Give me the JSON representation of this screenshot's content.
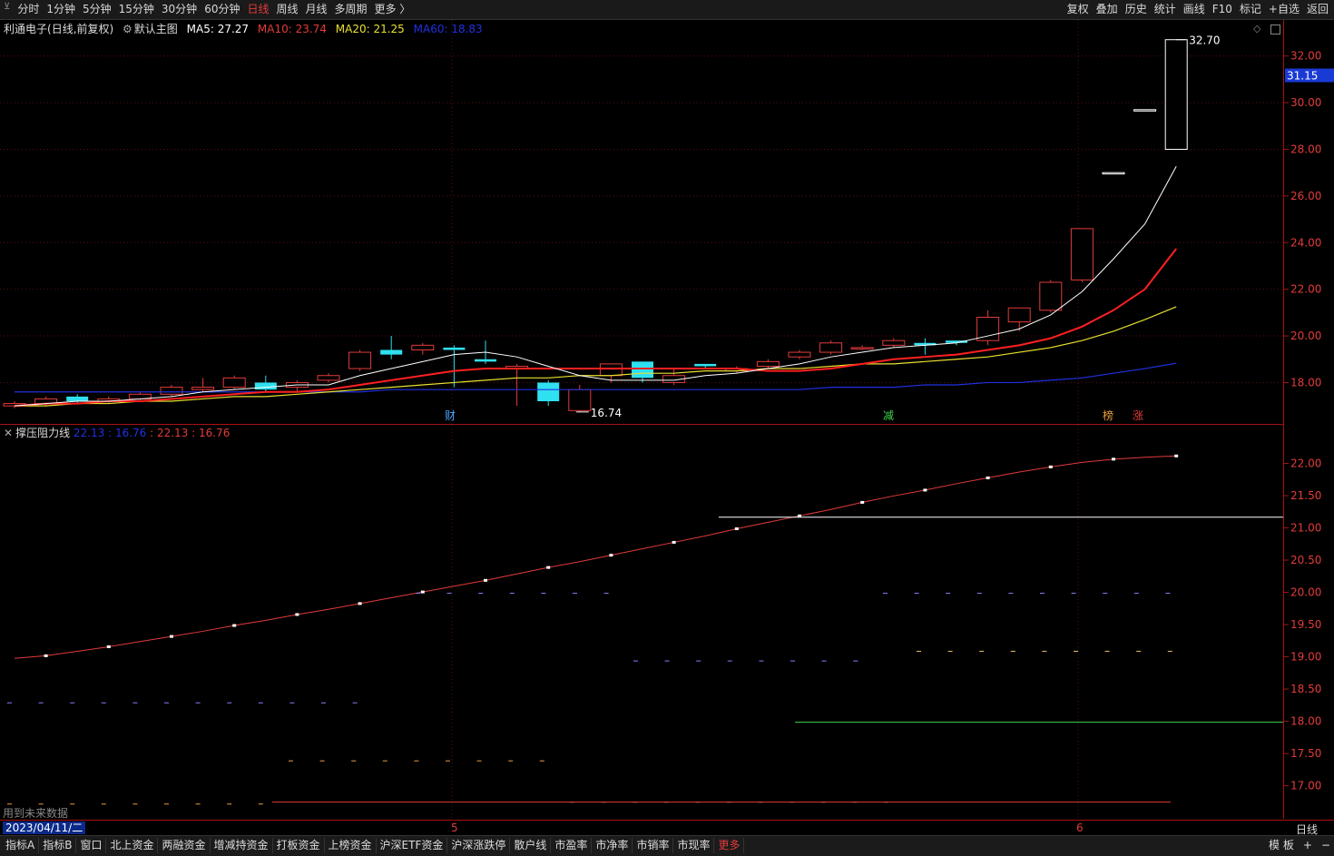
{
  "toolbar": {
    "left_items": [
      "分时",
      "1分钟",
      "5分钟",
      "15分钟",
      "30分钟",
      "60分钟",
      "日线",
      "周线",
      "月线",
      "多周期",
      "更多 〉"
    ],
    "active_index": 6,
    "right_items": [
      "复权",
      "叠加",
      "历史",
      "统计",
      "画线",
      "F10",
      "标记",
      "+自选",
      "返回"
    ]
  },
  "main_chart": {
    "stock_name": "利通电子",
    "period_label": "(日线,前复权)",
    "template_label": "默认主图",
    "ma5": "MA5: 27.27",
    "ma10": "MA10: 23.74",
    "ma20": "MA20: 21.25",
    "ma60": "MA60: 18.83",
    "high_label": "32.70",
    "low_label": "16.74",
    "current_price": "31.15",
    "y_ticks": [
      "32.00",
      "30.00",
      "28.00",
      "26.00",
      "24.00",
      "22.00",
      "20.00",
      "18.00"
    ],
    "markers": [
      {
        "text": "财",
        "color": "#4aa3ff"
      },
      {
        "text": "减",
        "color": "#3cd84c"
      },
      {
        "text": "榜",
        "color": "#e8a040"
      },
      {
        "text": "涨",
        "color": "#e23b3b"
      }
    ],
    "colors": {
      "up": "#e23b3b",
      "down": "#2fe0f0",
      "ma5": "#ffffff",
      "ma10": "#ff2020",
      "ma20": "#e8e030",
      "ma60": "#2030e0"
    }
  },
  "chart_data": {
    "type": "candlestick",
    "y_range": [
      16.5,
      33.0
    ],
    "candles": [
      [
        17.0,
        17.1,
        16.9,
        17.2
      ],
      [
        17.1,
        17.3,
        17.0,
        17.4
      ],
      [
        17.4,
        17.2,
        17.1,
        17.5
      ],
      [
        17.2,
        17.3,
        17.1,
        17.4
      ],
      [
        17.3,
        17.5,
        17.2,
        17.6
      ],
      [
        17.5,
        17.8,
        17.4,
        17.9
      ],
      [
        17.7,
        17.8,
        17.6,
        18.2
      ],
      [
        17.8,
        18.2,
        17.7,
        18.3
      ],
      [
        18.0,
        17.7,
        17.6,
        18.3
      ],
      [
        17.8,
        18.0,
        17.6,
        18.1
      ],
      [
        18.1,
        18.3,
        18.0,
        18.4
      ],
      [
        18.6,
        19.3,
        18.5,
        19.4
      ],
      [
        19.4,
        19.2,
        19.0,
        20.0
      ],
      [
        19.4,
        19.6,
        19.2,
        19.7
      ],
      [
        19.5,
        19.4,
        17.8,
        19.6
      ],
      [
        19.0,
        18.9,
        18.8,
        19.8
      ],
      [
        18.6,
        18.7,
        17.0,
        18.8
      ],
      [
        18.0,
        17.2,
        17.0,
        18.1
      ],
      [
        16.8,
        17.7,
        16.74,
        17.9
      ],
      [
        18.3,
        18.8,
        18.0,
        18.8
      ],
      [
        18.9,
        18.2,
        18.0,
        18.9
      ],
      [
        18.0,
        18.3,
        17.9,
        18.6
      ],
      [
        18.8,
        18.7,
        18.6,
        18.8
      ],
      [
        18.5,
        18.6,
        18.4,
        18.7
      ],
      [
        18.7,
        18.9,
        18.6,
        19.0
      ],
      [
        19.1,
        19.3,
        19.0,
        19.4
      ],
      [
        19.3,
        19.7,
        19.2,
        19.8
      ],
      [
        19.5,
        19.5,
        19.4,
        19.6
      ],
      [
        19.6,
        19.8,
        19.5,
        19.9
      ],
      [
        19.7,
        19.6,
        19.2,
        19.9
      ],
      [
        19.8,
        19.7,
        19.6,
        19.8
      ],
      [
        19.8,
        20.8,
        19.6,
        21.1
      ],
      [
        20.6,
        21.2,
        20.2,
        21.2
      ],
      [
        21.1,
        22.3,
        21.0,
        22.4
      ],
      [
        22.4,
        24.6,
        22.3,
        24.6
      ],
      [
        27.0,
        27.0,
        27.0,
        27.0
      ],
      [
        29.7,
        29.7,
        29.7,
        29.7
      ],
      [
        28.0,
        32.7,
        28.0,
        32.7
      ]
    ],
    "ma5": [
      17.0,
      17.1,
      17.2,
      17.2,
      17.3,
      17.4,
      17.6,
      17.7,
      17.8,
      17.9,
      17.9,
      18.3,
      18.6,
      18.9,
      19.2,
      19.3,
      19.1,
      18.7,
      18.3,
      18.1,
      18.1,
      18.1,
      18.3,
      18.4,
      18.6,
      18.8,
      19.1,
      19.3,
      19.5,
      19.6,
      19.7,
      20.0,
      20.3,
      20.9,
      21.9,
      23.3,
      24.8,
      27.27
    ],
    "ma10": [
      17.0,
      17.1,
      17.1,
      17.2,
      17.2,
      17.3,
      17.4,
      17.5,
      17.6,
      17.6,
      17.7,
      17.9,
      18.1,
      18.3,
      18.5,
      18.6,
      18.6,
      18.6,
      18.6,
      18.6,
      18.6,
      18.6,
      18.6,
      18.6,
      18.5,
      18.5,
      18.6,
      18.8,
      19.0,
      19.1,
      19.2,
      19.4,
      19.6,
      19.9,
      20.4,
      21.1,
      22.0,
      23.74
    ],
    "ma20": [
      17.0,
      17.0,
      17.1,
      17.1,
      17.2,
      17.2,
      17.3,
      17.4,
      17.4,
      17.5,
      17.6,
      17.7,
      17.8,
      17.9,
      18.0,
      18.1,
      18.2,
      18.2,
      18.3,
      18.3,
      18.4,
      18.4,
      18.5,
      18.5,
      18.6,
      18.6,
      18.7,
      18.8,
      18.8,
      18.9,
      19.0,
      19.1,
      19.3,
      19.5,
      19.8,
      20.2,
      20.7,
      21.25
    ],
    "ma60": [
      17.6,
      17.6,
      17.6,
      17.6,
      17.6,
      17.6,
      17.6,
      17.6,
      17.6,
      17.6,
      17.6,
      17.6,
      17.7,
      17.7,
      17.7,
      17.7,
      17.7,
      17.7,
      17.7,
      17.7,
      17.7,
      17.7,
      17.7,
      17.7,
      17.7,
      17.7,
      17.8,
      17.8,
      17.8,
      17.9,
      17.9,
      18.0,
      18.0,
      18.1,
      18.2,
      18.4,
      18.6,
      18.83
    ]
  },
  "sub_chart": {
    "title": "撑压阻力线",
    "val1": "22.13",
    "val2": "16.76",
    "val3": "22.13",
    "val4": "16.76",
    "y_ticks": [
      "22.00",
      "21.50",
      "21.00",
      "20.50",
      "20.00",
      "19.50",
      "19.00",
      "18.50",
      "18.00",
      "17.50",
      "17.00"
    ],
    "y_range": [
      16.6,
      22.5
    ],
    "support_line": [
      18.99,
      19.03,
      19.1,
      19.17,
      19.25,
      19.33,
      19.41,
      19.5,
      19.58,
      19.67,
      19.75,
      19.84,
      19.93,
      20.02,
      20.11,
      20.2,
      20.3,
      20.4,
      20.49,
      20.59,
      20.69,
      20.79,
      20.89,
      21.0,
      21.1,
      21.2,
      21.3,
      21.41,
      21.51,
      21.6,
      21.7,
      21.79,
      21.88,
      21.96,
      22.03,
      22.08,
      22.11,
      22.13
    ],
    "white_level": 21.18,
    "green_level": 18.0,
    "note": "用到未来数据"
  },
  "date_bar": {
    "date": "2023/04/11/二",
    "marks": [
      "5",
      "6"
    ],
    "period_right": "日线"
  },
  "bottom_tabs": [
    "指标A",
    "指标B",
    "窗口",
    "北上资金",
    "两融资金",
    "增减持资金",
    "打板资金",
    "上榜资金",
    "沪深ETF资金",
    "沪深涨跌停",
    "散户线",
    "市盈率",
    "市净率",
    "市销率",
    "市现率",
    "更多"
  ],
  "bottom_right": [
    "模 板",
    "+",
    "−"
  ]
}
